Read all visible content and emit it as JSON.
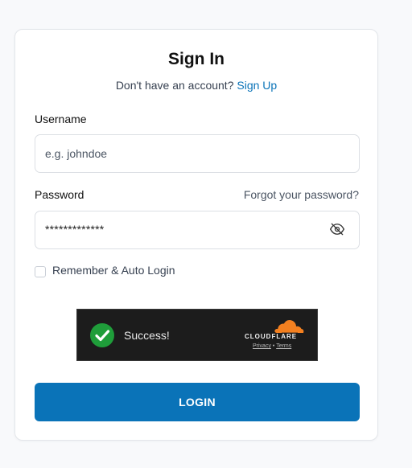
{
  "form": {
    "title": "Sign In",
    "subtitle_text": "Don't have an account? ",
    "signup_link": "Sign Up",
    "username_label": "Username",
    "username_placeholder": "e.g. johndoe",
    "password_label": "Password",
    "forgot_link": "Forgot your password?",
    "password_masked": "*************",
    "remember_label": "Remember & Auto Login",
    "remember_checked": false,
    "login_label": "LOGIN"
  },
  "captcha": {
    "status": "Success!",
    "brand": "CLOUDFLARE",
    "privacy_link": "Privacy",
    "separator": "•",
    "terms_link": "Terms"
  },
  "icons": {
    "password_toggle": "eye-off-icon",
    "captcha_status": "check-circle-icon",
    "captcha_logo": "cloudflare-cloud-icon"
  },
  "colors": {
    "accent": "#0a73b8",
    "success": "#1f9d3a",
    "cloudflare_orange": "#f38020"
  }
}
